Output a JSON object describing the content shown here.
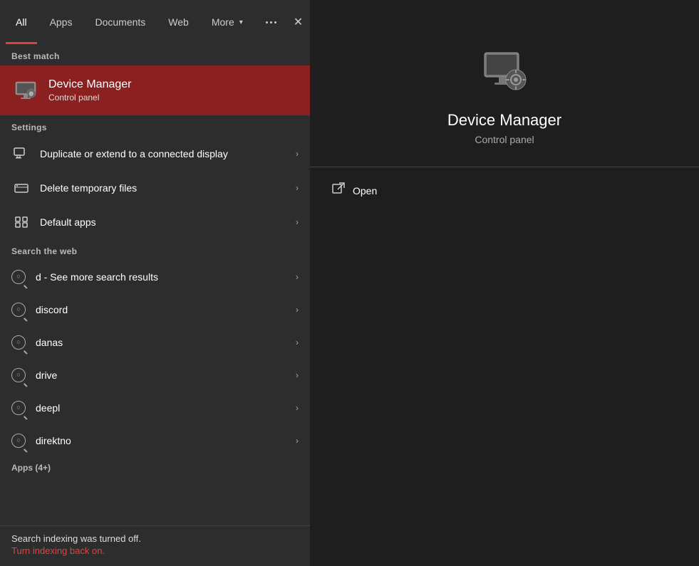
{
  "tabs": [
    {
      "id": "all",
      "label": "All",
      "active": true
    },
    {
      "id": "apps",
      "label": "Apps",
      "active": false
    },
    {
      "id": "documents",
      "label": "Documents",
      "active": false
    },
    {
      "id": "web",
      "label": "Web",
      "active": false
    },
    {
      "id": "more",
      "label": "More",
      "active": false,
      "hasArrow": true
    }
  ],
  "best_match": {
    "section_label": "Best match",
    "title": "Device Manager",
    "subtitle": "Control panel"
  },
  "settings": {
    "section_label": "Settings",
    "items": [
      {
        "id": "display",
        "label": "Duplicate or extend to a connected display",
        "icon": "monitor"
      },
      {
        "id": "temp",
        "label": "Delete temporary files",
        "icon": "storage"
      },
      {
        "id": "apps",
        "label": "Default apps",
        "icon": "grid"
      }
    ]
  },
  "search_web": {
    "section_label": "Search the web",
    "items": [
      {
        "id": "see-more",
        "label": "d - See more search results"
      },
      {
        "id": "discord",
        "label": "discord"
      },
      {
        "id": "danas",
        "label": "danas"
      },
      {
        "id": "drive",
        "label": "drive"
      },
      {
        "id": "deepl",
        "label": "deepl"
      },
      {
        "id": "direktno",
        "label": "direktno"
      }
    ]
  },
  "apps_section": {
    "label": "Apps (4+)"
  },
  "status": {
    "message": "Search indexing was turned off.",
    "link": "Turn indexing back on."
  },
  "right_panel": {
    "title": "Device Manager",
    "subtitle": "Control panel",
    "open_label": "Open"
  }
}
